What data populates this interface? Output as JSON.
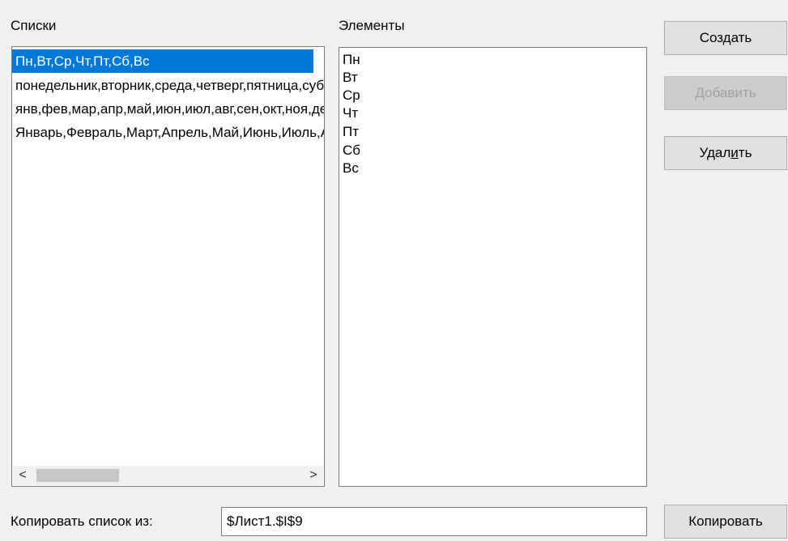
{
  "lists_label": "Списки",
  "elements_label": "Элементы",
  "lists": [
    {
      "text": "Пн,Вт,Ср,Чт,Пт,Сб,Вс",
      "selected": true
    },
    {
      "text": "понедельник,вторник,среда,четверг,пятница,суббота,воскресенье",
      "selected": false
    },
    {
      "text": "янв,фев,мар,апр,май,июн,июл,авг,сен,окт,ноя,дек",
      "selected": false
    },
    {
      "text": "Январь,Февраль,Март,Апрель,Май,Июнь,Июль,Август,Сентябрь,Октябрь,Ноябрь,Декабрь",
      "selected": false
    }
  ],
  "elements": [
    "Пн",
    "Вт",
    "Ср",
    "Чт",
    "Пт",
    "Сб",
    "Вс"
  ],
  "buttons": {
    "create": "Создать",
    "add": "Добавить",
    "delete_pre": "Удал",
    "delete_accel": "и",
    "delete_post": "ть",
    "copy": "Копировать"
  },
  "copy_from": {
    "label": "Копировать список из:",
    "value": "$Лист1.$I$9"
  },
  "scroll": {
    "left_glyph": "<",
    "right_glyph": ">"
  },
  "colors": {
    "selection": "#0078d7"
  }
}
